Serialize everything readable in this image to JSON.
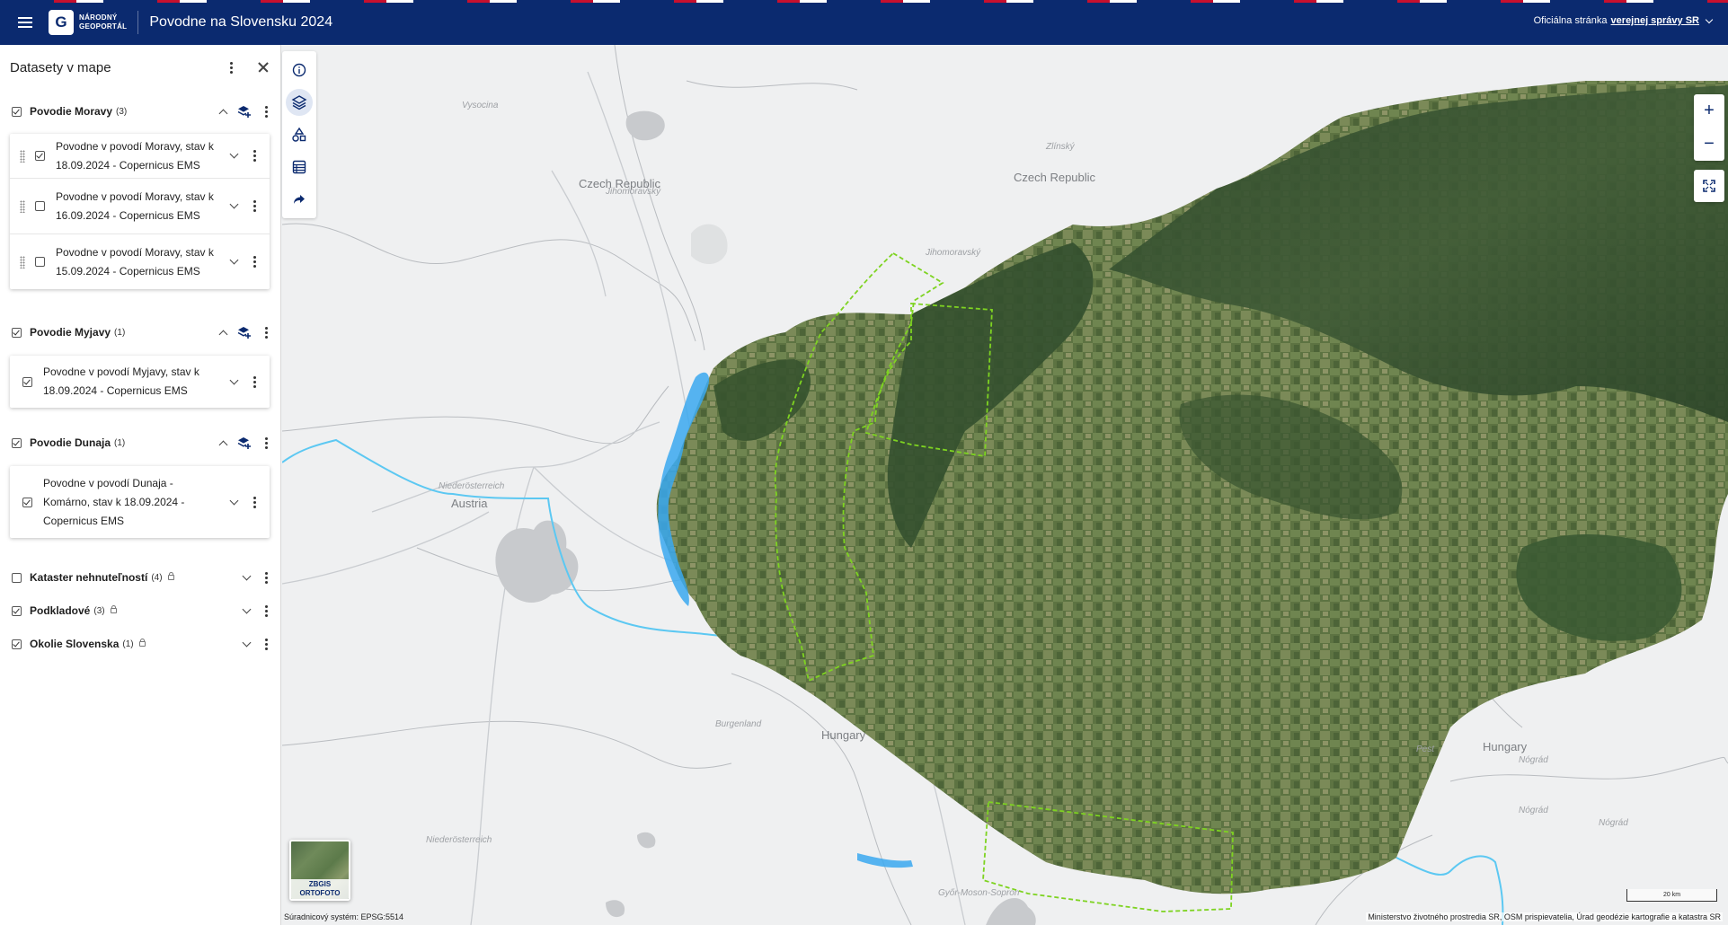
{
  "header": {
    "logo_letter": "G",
    "logo_line1": "NÁRODNÝ",
    "logo_line2": "GEOPORTÁL",
    "title": "Povodne na Slovensku 2024",
    "official_prefix": "Oficiálna stránka",
    "official_link": "verejnej správy SR"
  },
  "panel": {
    "title": "Datasety v mape",
    "groups": [
      {
        "name": "Povodie Moravy",
        "count": "(3)",
        "checked": true,
        "items": [
          {
            "line1": "Povodne v povodí Moravy, stav k",
            "line2": "18.09.2024 - Copernicus EMS",
            "checked": true
          },
          {
            "line1": "Povodne v povodí Moravy, stav k",
            "line2": "16.09.2024 - Copernicus EMS",
            "checked": false
          },
          {
            "line1": "Povodne v povodí Moravy, stav k",
            "line2": "15.09.2024 - Copernicus EMS",
            "checked": false
          }
        ]
      },
      {
        "name": "Povodie Myjavy",
        "count": "(1)",
        "checked": true,
        "items": [
          {
            "line1": "Povodne v povodí Myjavy, stav k",
            "line2": "18.09.2024 - Copernicus EMS",
            "checked": true
          }
        ]
      },
      {
        "name": "Povodie Dunaja",
        "count": "(1)",
        "checked": true,
        "items": [
          {
            "line1": "Povodne v povodí Dunaja -",
            "line2": "Komárno, stav k 18.09.2024 -",
            "line3": "Copernicus EMS",
            "checked": true
          }
        ]
      },
      {
        "name": "Kataster nehnuteľností",
        "count": "(4)",
        "checked": false,
        "locked": true
      },
      {
        "name": "Podkladové",
        "count": "(3)",
        "checked": true,
        "locked": true
      },
      {
        "name": "Okolie Slovenska",
        "count": "(1)",
        "checked": true,
        "locked": true
      }
    ]
  },
  "rail": {
    "icons": [
      "info-icon",
      "layers-icon",
      "shapes-icon",
      "table-icon",
      "share-icon"
    ],
    "active": "layers-icon"
  },
  "map": {
    "labels": {
      "czech_republic_1": "Czech Republic",
      "czech_republic_2": "Czech Republic",
      "austria": "Austria",
      "hungary_1": "Hungary",
      "hungary_2": "Hungary",
      "vysocina": "Vysocina",
      "jihomoravsky_1": "Jihomoravský",
      "jihomoravsky_2": "Jihomoravský",
      "zlinsky": "Zlínský",
      "niederosterreich_1": "Niederösterreich",
      "niederosterreich_2": "Niederösterreich",
      "burgenland": "Burgenland",
      "gyor": "Győr-Moson-Sopron",
      "pest": "Pest",
      "nograd_1": "Nógrád",
      "nograd_2": "Nógrád",
      "nograd_3": "Nógrád"
    },
    "zoom_in": "+",
    "zoom_out": "−",
    "basemap_line1": "ZBGIS",
    "basemap_line2": "ORTOFOTO",
    "scale": "20 km",
    "coordinate_system": "Súradnicový systém: EPSG:5514",
    "attribution": "Ministerstvo životného prostredia SR, OSM prispievatelia, Úrad geodézie kartografie a katastra SR"
  },
  "colors": {
    "header_bg": "#0b2a6f",
    "flood_extent": "#3aa8f0",
    "aoi_outline": "#7ed321",
    "river": "#5cc8f2"
  }
}
